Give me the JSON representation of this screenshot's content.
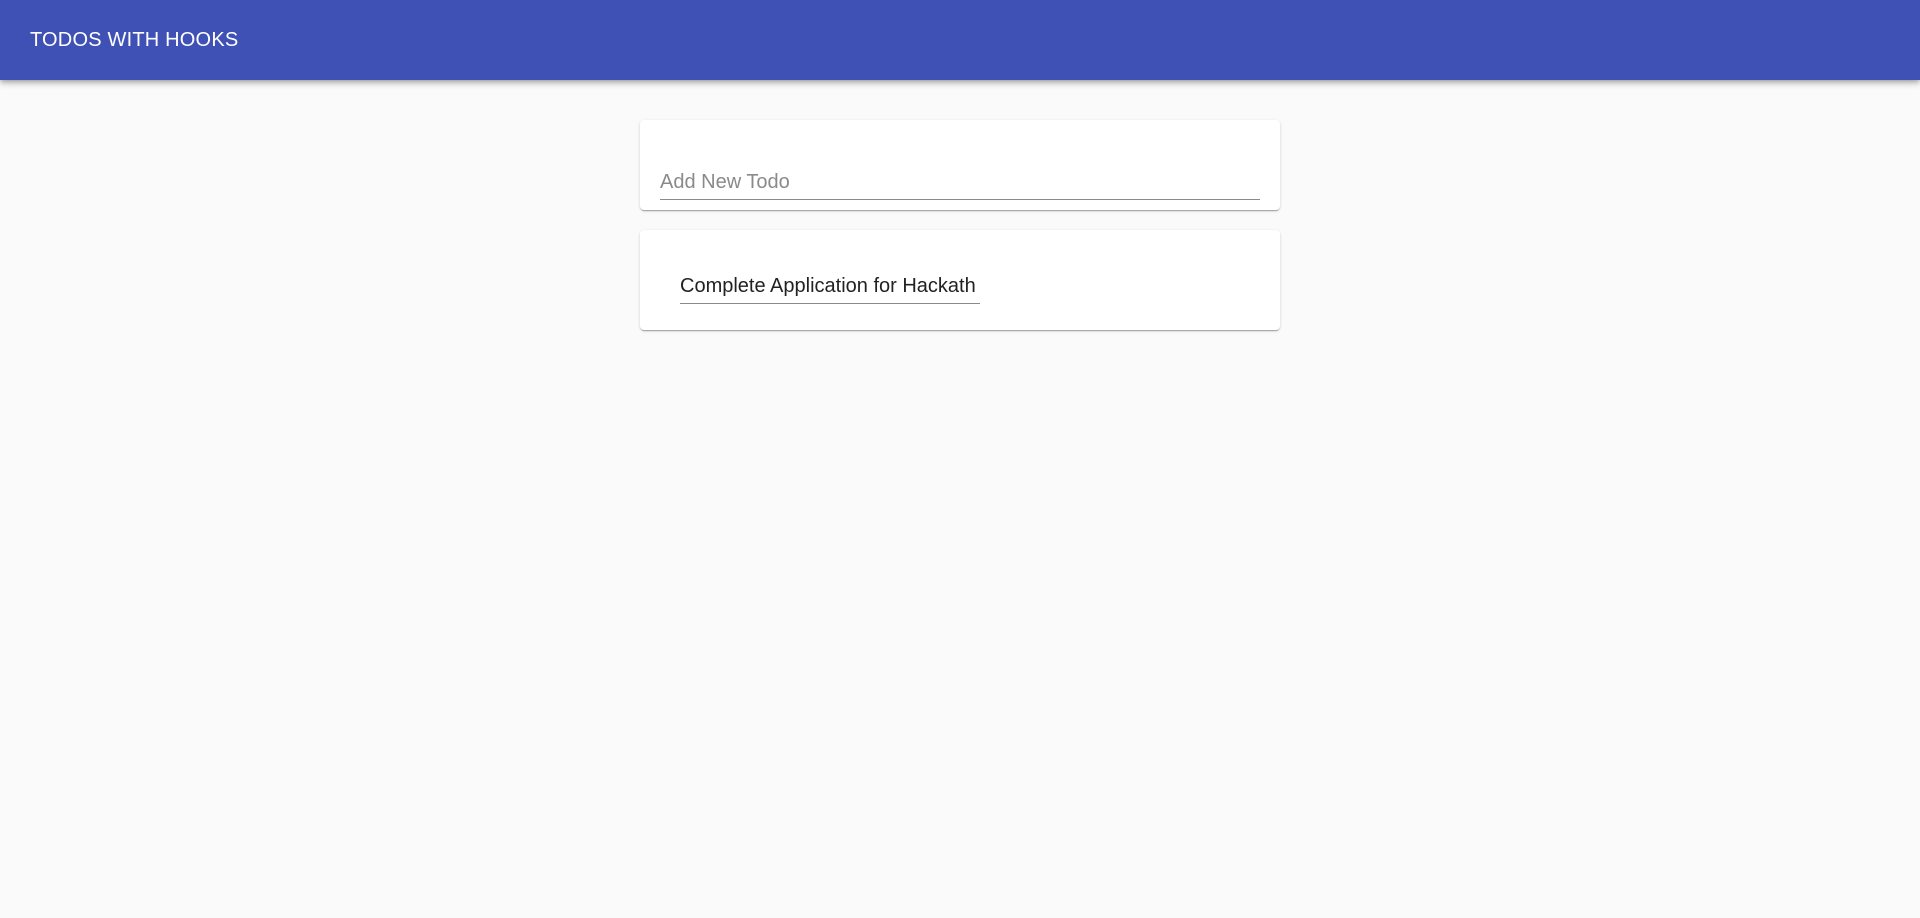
{
  "app_bar": {
    "title": "TODOS WITH HOOKS",
    "background_color": "#3f51b5"
  },
  "new_todo": {
    "placeholder": "Add New Todo",
    "value": ""
  },
  "todos": [
    {
      "text": "Complete Application for Hackath"
    }
  ]
}
